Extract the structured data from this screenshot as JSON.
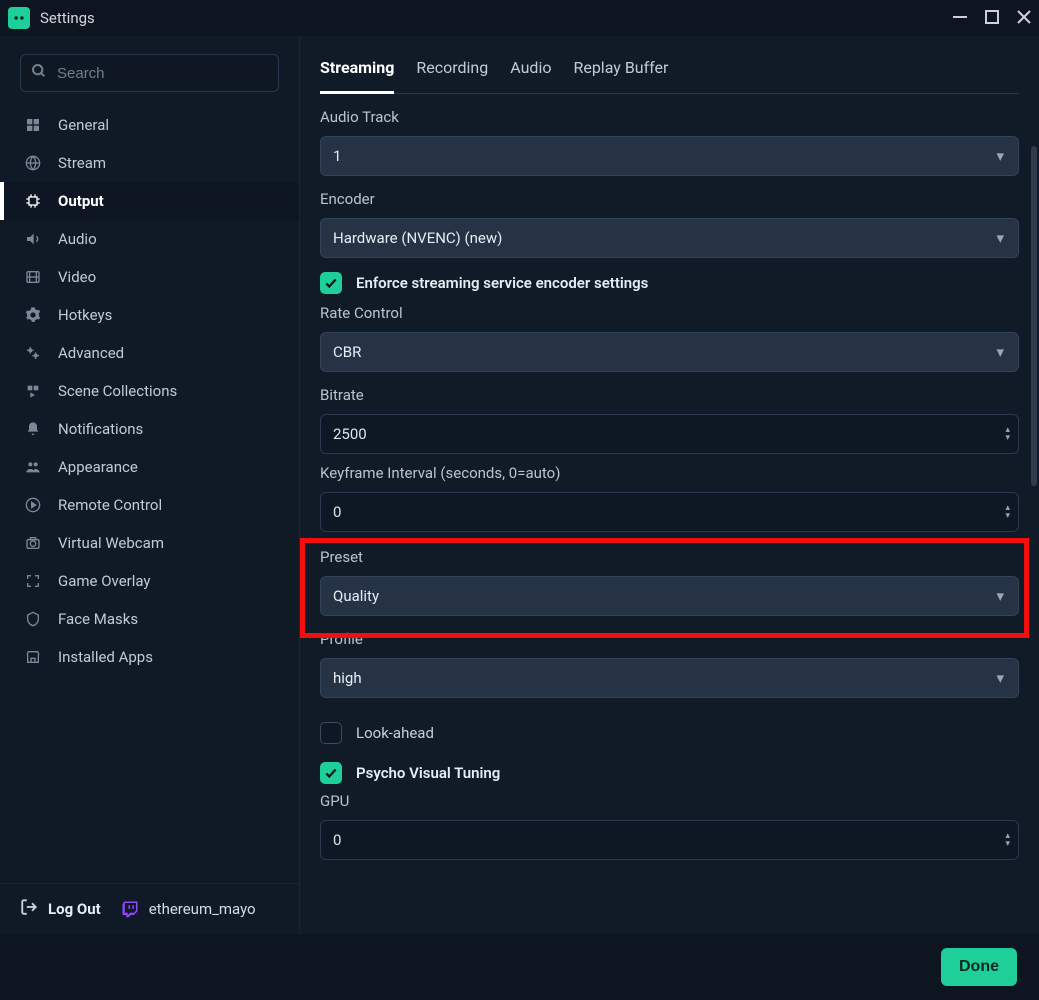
{
  "window": {
    "title": "Settings"
  },
  "search": {
    "placeholder": "Search"
  },
  "sidebar": {
    "items": [
      {
        "label": "General",
        "icon": "grid"
      },
      {
        "label": "Stream",
        "icon": "globe"
      },
      {
        "label": "Output",
        "icon": "chip",
        "active": true
      },
      {
        "label": "Audio",
        "icon": "speaker"
      },
      {
        "label": "Video",
        "icon": "film"
      },
      {
        "label": "Hotkeys",
        "icon": "gear"
      },
      {
        "label": "Advanced",
        "icon": "gears"
      },
      {
        "label": "Scene Collections",
        "icon": "play"
      },
      {
        "label": "Notifications",
        "icon": "bell"
      },
      {
        "label": "Appearance",
        "icon": "people"
      },
      {
        "label": "Remote Control",
        "icon": "circle-play"
      },
      {
        "label": "Virtual Webcam",
        "icon": "camera"
      },
      {
        "label": "Game Overlay",
        "icon": "expand"
      },
      {
        "label": "Face Masks",
        "icon": "shield"
      },
      {
        "label": "Installed Apps",
        "icon": "shop"
      }
    ]
  },
  "footer_sidebar": {
    "logout": "Log Out",
    "username": "ethereum_mayo"
  },
  "main": {
    "tabs": [
      {
        "label": "Streaming",
        "active": true
      },
      {
        "label": "Recording"
      },
      {
        "label": "Audio"
      },
      {
        "label": "Replay Buffer"
      }
    ],
    "fields": {
      "audio_track": {
        "label": "Audio Track",
        "value": "1"
      },
      "encoder": {
        "label": "Encoder",
        "value": "Hardware (NVENC) (new)"
      },
      "enforce": {
        "label": "Enforce streaming service encoder settings",
        "checked": true
      },
      "rate_control": {
        "label": "Rate Control",
        "value": "CBR"
      },
      "bitrate": {
        "label": "Bitrate",
        "value": "2500"
      },
      "keyframe": {
        "label": "Keyframe Interval (seconds, 0=auto)",
        "value": "0"
      },
      "preset": {
        "label": "Preset",
        "value": "Quality"
      },
      "profile": {
        "label": "Profile",
        "value": "high"
      },
      "lookahead": {
        "label": "Look-ahead",
        "checked": false
      },
      "psycho": {
        "label": "Psycho Visual Tuning",
        "checked": true
      },
      "gpu": {
        "label": "GPU",
        "value": "0"
      }
    }
  },
  "footer": {
    "done": "Done"
  },
  "colors": {
    "accent": "#1fcf9a",
    "highlight": "#f40e0e"
  }
}
